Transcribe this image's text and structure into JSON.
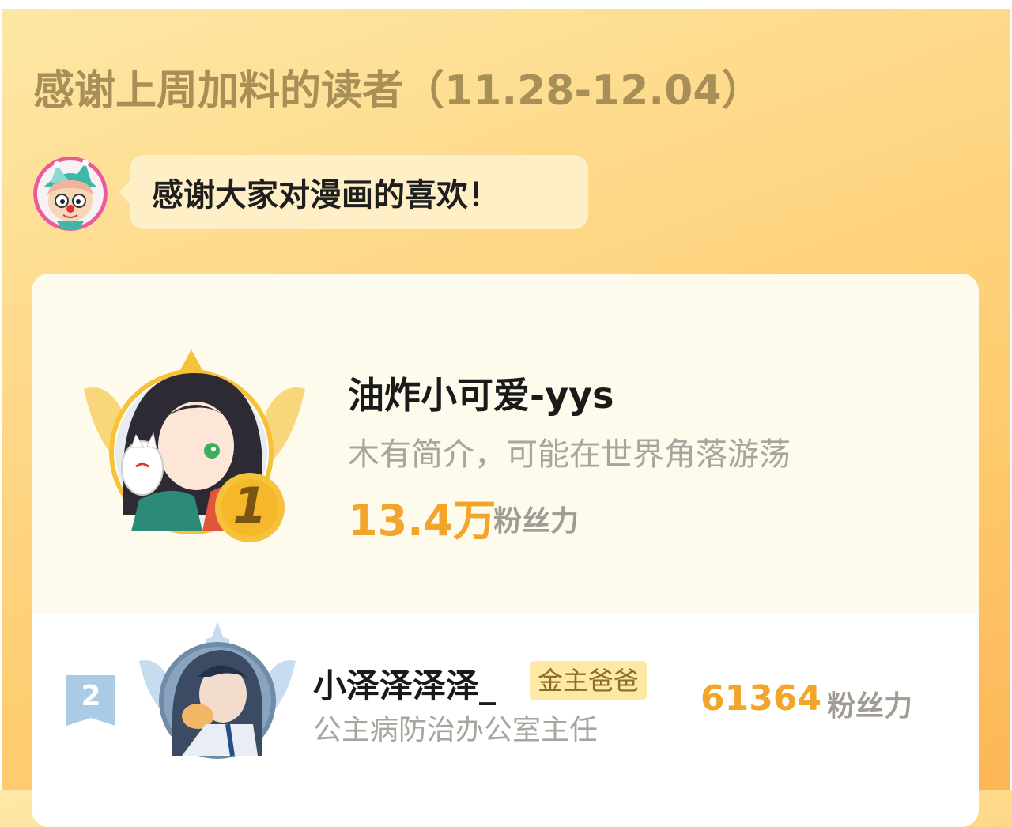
{
  "header": {
    "title": "感谢上周加料的读者（11.28-12.04）"
  },
  "mascot": {
    "icon": "clown-mascot-icon",
    "message": "感谢大家对漫画的喜欢！"
  },
  "ranking": [
    {
      "rank": "1",
      "name": "油炸小可爱-yys",
      "bio": "木有简介，可能在世界角落游荡",
      "fans_value": "13.4万",
      "fans_label": "粉丝力"
    },
    {
      "rank": "2",
      "name": "小泽泽泽泽_",
      "badge": "金主爸爸",
      "bio": "公主病防治办公室主任",
      "fans_value": "61364",
      "fans_label": "粉丝力"
    }
  ],
  "colors": {
    "accent_orange": "#f3a42a",
    "title_brown": "#a78f57",
    "gold": "#f6c23a",
    "silver_blue": "#a9cbe6"
  }
}
